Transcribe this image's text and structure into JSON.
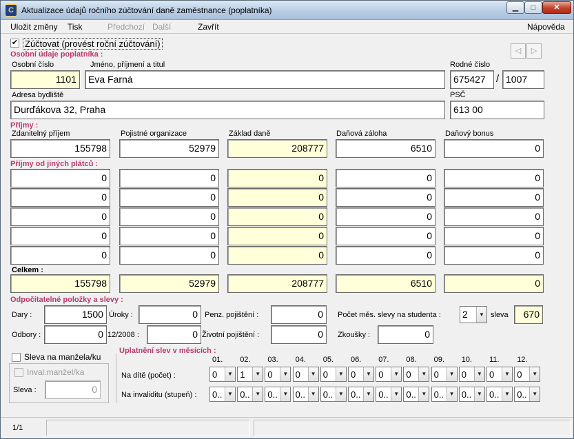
{
  "window": {
    "title": "Aktualizace údajů ročního zúčtování daně zaměstnance (poplatníka)"
  },
  "menu": {
    "save": "Uložit změny",
    "print": "Tisk",
    "prev": "Předchozí",
    "next": "Další",
    "close": "Zavřít",
    "help": "Nápověda"
  },
  "settle_label": "Zúčtovat (provést roční zúčtování)",
  "personal": {
    "section": "Osobní údaje poplatníka :",
    "id_label": "Osobní číslo",
    "id": "1101",
    "name_label": "Jméno, příjmení a titul",
    "name": "Eva Farná",
    "birth_label": "Rodné číslo",
    "birth1": "675427",
    "birth2": "1007",
    "addr_label": "Adresa bydliště",
    "addr": "Durďákova 32, Praha",
    "psc_label": "PSČ",
    "psc": "613 00"
  },
  "income": {
    "section": "Příjmy :",
    "col_taxable": "Zdanitelný příjem",
    "col_insurance": "Pojistné organizace",
    "col_base": "Základ daně",
    "col_advance": "Daňová záloha",
    "col_bonus": "Daňový bonus",
    "main": [
      "155798",
      "52979",
      "208777",
      "6510",
      "0"
    ],
    "other_section": "Příjmy od jiných plátců :",
    "other": [
      [
        "0",
        "0",
        "0",
        "0",
        "0"
      ],
      [
        "0",
        "0",
        "0",
        "0",
        "0"
      ],
      [
        "0",
        "0",
        "0",
        "0",
        "0"
      ],
      [
        "0",
        "0",
        "0",
        "0",
        "0"
      ],
      [
        "0",
        "0",
        "0",
        "0",
        "0"
      ]
    ],
    "total_label": "Celkem :",
    "total": [
      "155798",
      "52979",
      "208777",
      "6510",
      "0"
    ]
  },
  "deductions": {
    "section": "Odpočitatelné položky a slevy :",
    "gifts_label": "Dary :",
    "gifts": "1500",
    "interest_label": "Úroky :",
    "interest": "0",
    "pension_label": "Penz. pojištění :",
    "pension": "0",
    "student_label": "Počet měs. slevy na studenta :",
    "student_months": "2",
    "discount_label": "sleva",
    "discount": "670",
    "unions_label": "Odbory :",
    "unions": "0",
    "date_label": "12/2008 :",
    "date_val": "0",
    "life_label": "Životní pojištění :",
    "life": "0",
    "exams_label": "Zkoušky :",
    "exams": "0"
  },
  "spouse": {
    "label": "Sleva na manžela/ku",
    "inval_label": "Inval.manžel/ka",
    "sleva_label": "Sleva :",
    "sleva": "0"
  },
  "monthly": {
    "section": "Uplatnění slev v měsících :",
    "months": [
      "01.",
      "02.",
      "03.",
      "04.",
      "05.",
      "06.",
      "07.",
      "08.",
      "09.",
      "10.",
      "11.",
      "12."
    ],
    "children_label": "Na dítě (počet) :",
    "children": [
      "0",
      "1",
      "0",
      "0",
      "0",
      "0",
      "0",
      "0",
      "0",
      "0",
      "0",
      "0"
    ],
    "disability_label": "Na invaliditu (stupeň) :",
    "disability": [
      "0..",
      "0..",
      "0..",
      "0..",
      "0..",
      "0..",
      "0..",
      "0..",
      "0..",
      "0..",
      "0..",
      "0.."
    ]
  },
  "status": {
    "record": "1/1"
  }
}
